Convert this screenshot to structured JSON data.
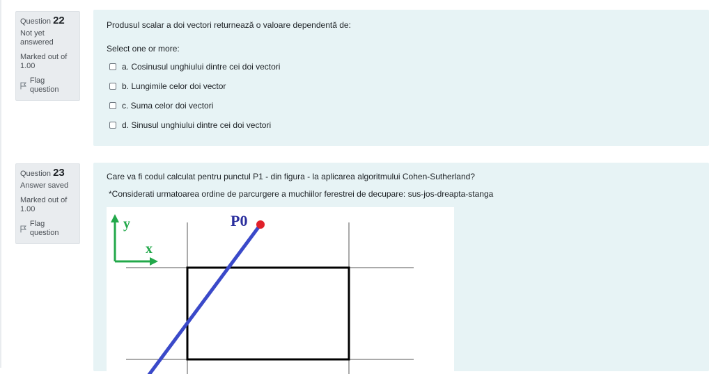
{
  "questions": [
    {
      "label": "Question",
      "number": "22",
      "state": "Not yet answered",
      "grade": "Marked out of 1.00",
      "flag_label": "Flag question",
      "text": "Produsul scalar a doi vectori returnează o valoare dependentă de:",
      "prompt": "Select one or more:",
      "options": [
        {
          "text": "a. Cosinusul unghiului dintre cei doi vectori",
          "checked": false
        },
        {
          "text": "b. Lungimile celor doi vector",
          "checked": false
        },
        {
          "text": "c. Suma celor doi vectori",
          "checked": false
        },
        {
          "text": "d. Sinusul unghiului dintre cei doi vectori",
          "checked": false
        }
      ]
    },
    {
      "label": "Question",
      "number": "23",
      "state": "Answer saved",
      "grade": "Marked out of 1.00",
      "flag_label": "Flag question",
      "text": "Care va fi codul calculat pentru punctul P1 - din figura - la aplicarea algoritmului Cohen-Sutherland?",
      "subtext": "*Considerati urmatoarea ordine de parcurgere a muchiilor ferestrei de decupare: sus-jos-dreapta-stanga",
      "figure": {
        "axis_y_label": "y",
        "axis_x_label": "x",
        "point_label": "P0",
        "axis_color": "#22a84a",
        "segment_color": "#3a49c9",
        "point_color": "#e0202a",
        "label_color": "#2b2f9e"
      }
    }
  ],
  "theme": {
    "info_bg": "#e9ecef",
    "content_bg": "#e7f3f5"
  }
}
